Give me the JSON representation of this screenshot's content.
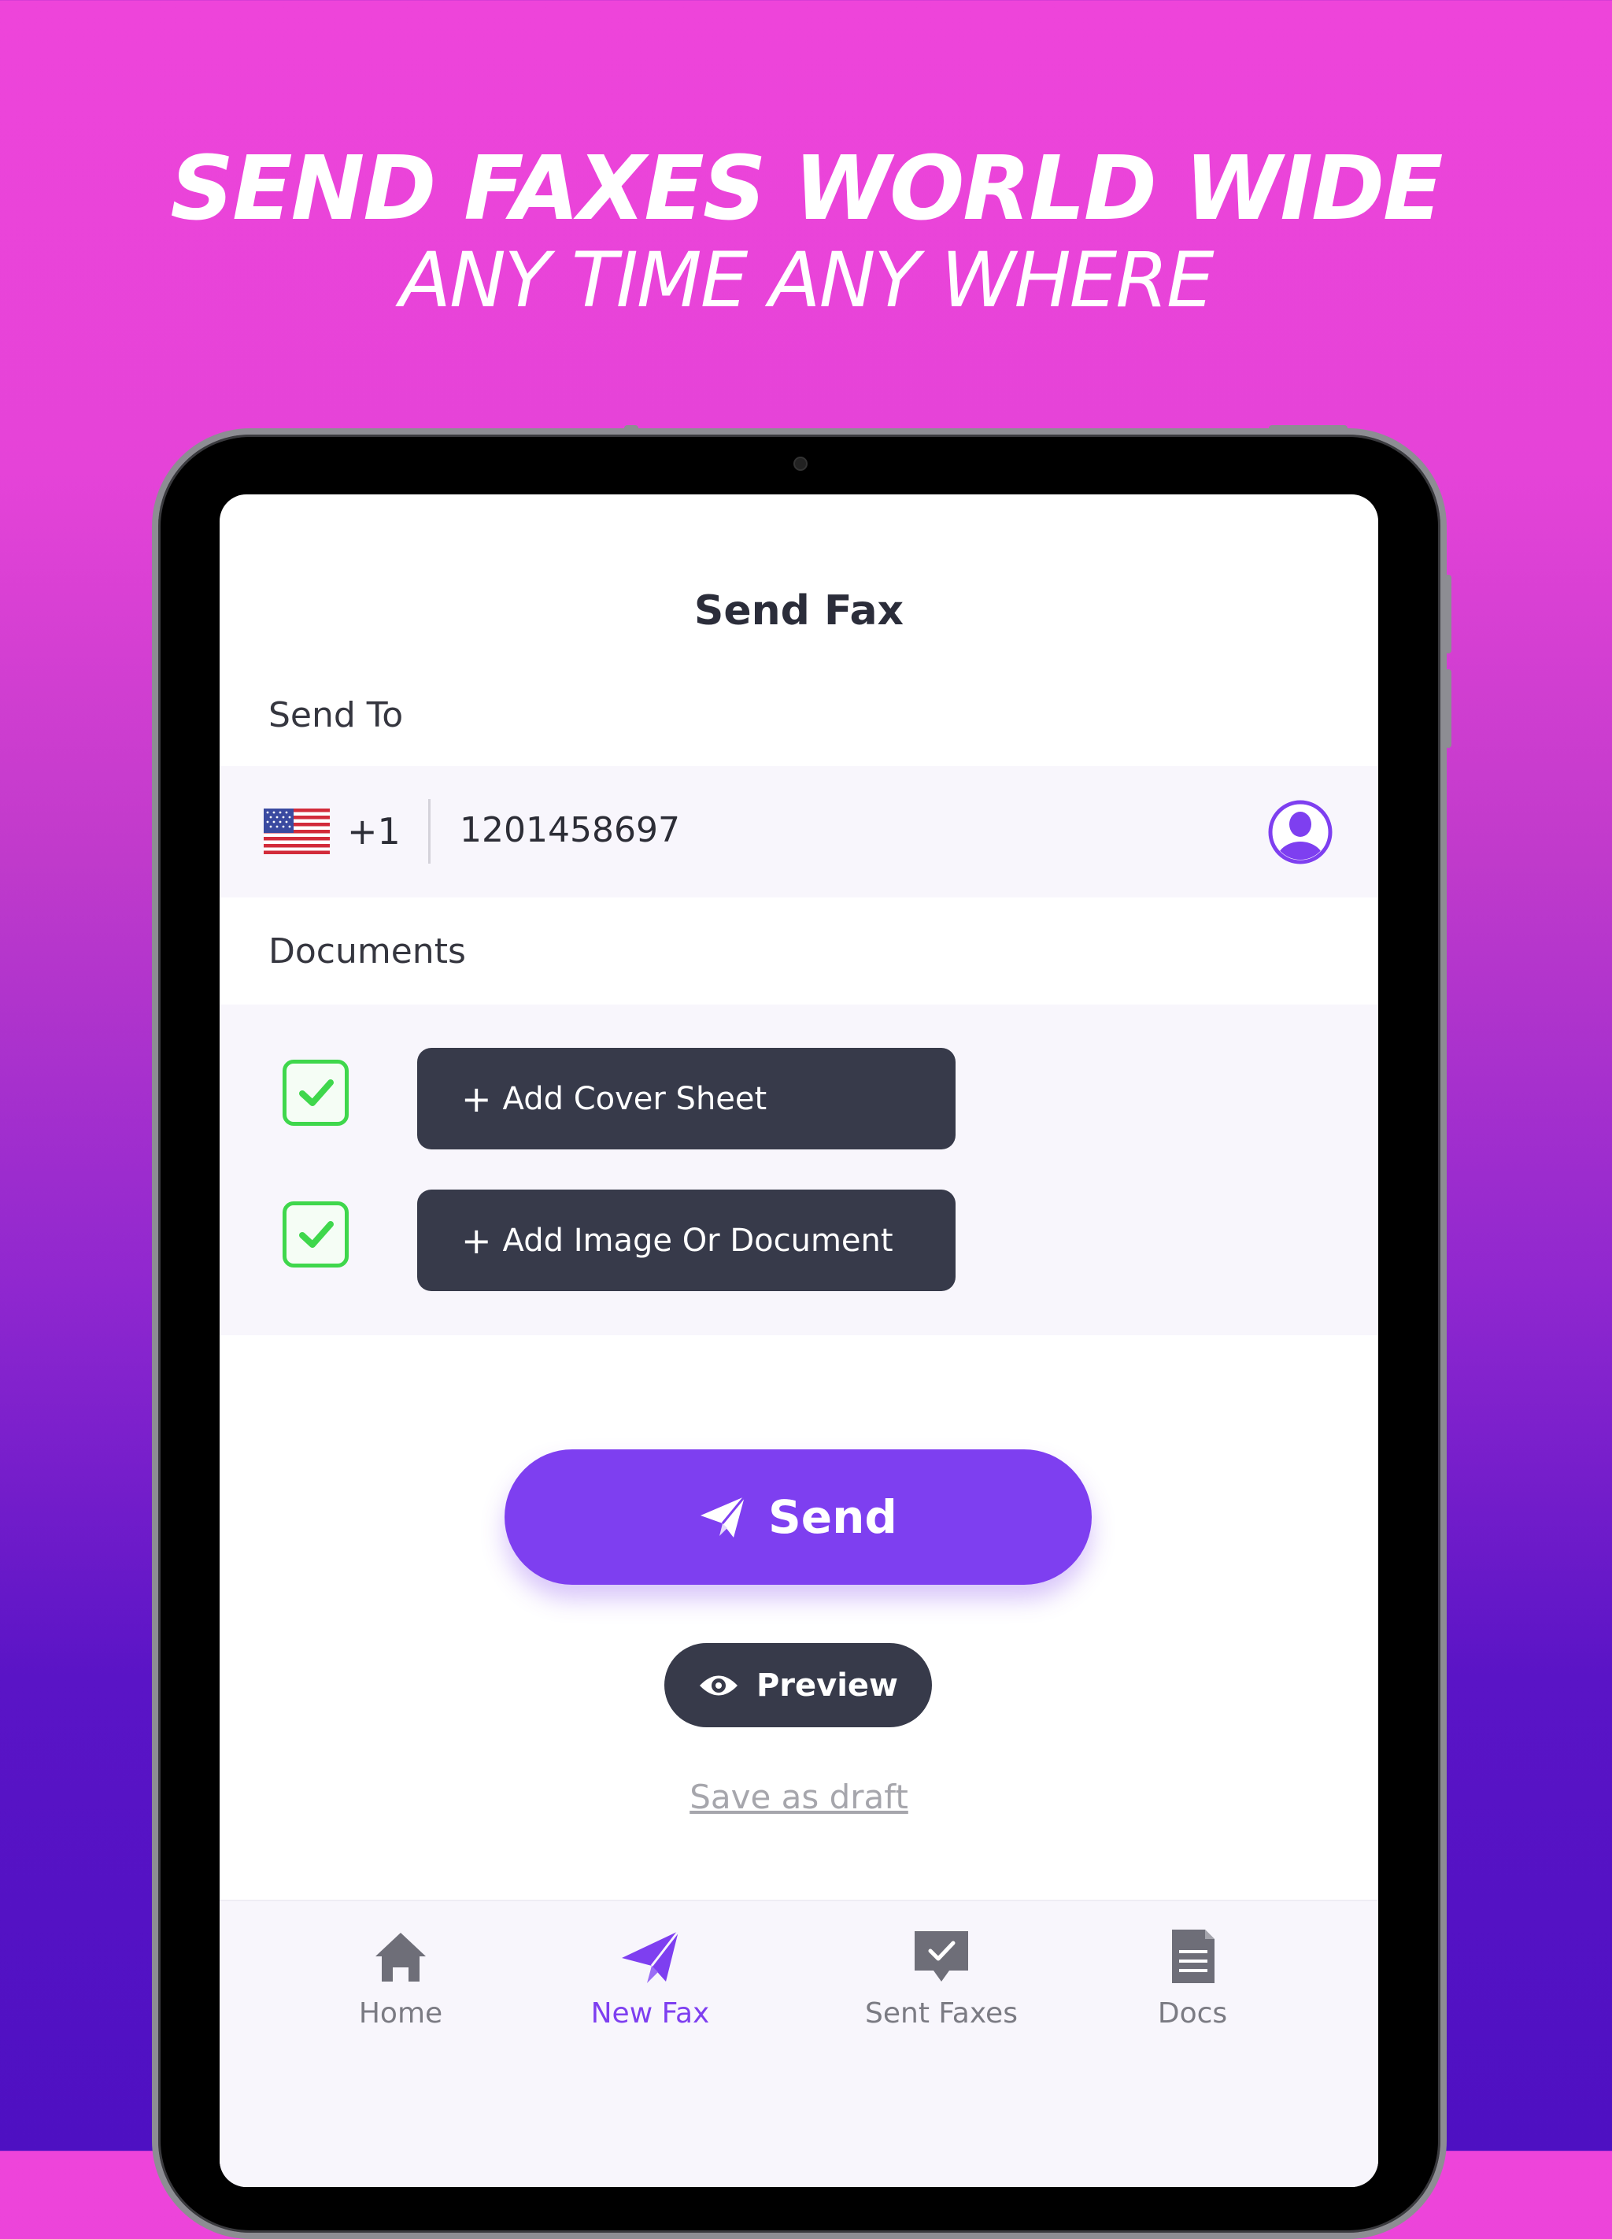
{
  "promo": {
    "headline": "SEND FAXES WORLD WIDE",
    "subheadline": "ANY TIME ANY WHERE"
  },
  "screen": {
    "title": "Send Fax",
    "send_to_label": "Send To",
    "phone": {
      "flag_icon": "us-flag-icon",
      "country_code": "+1",
      "number": "1201458697",
      "contact_icon": "contact-person-icon"
    },
    "documents_label": "Documents",
    "documents": [
      {
        "checked": true,
        "label": "Add Cover Sheet"
      },
      {
        "checked": true,
        "label": "Add Image Or Document"
      }
    ],
    "send_label": "Send",
    "preview_label": "Preview",
    "draft_label": "Save as draft"
  },
  "tabs": [
    {
      "label": "Home",
      "icon": "home-icon",
      "active": false
    },
    {
      "label": "New Fax",
      "icon": "paper-plane-icon",
      "active": true
    },
    {
      "label": "Sent Faxes",
      "icon": "sent-check-icon",
      "active": false
    },
    {
      "label": "Docs",
      "icon": "document-icon",
      "active": false
    }
  ],
  "colors": {
    "accent": "#7e3ff0",
    "dark_button": "#373a4a",
    "check_green": "#3fd74c",
    "background_top": "#ee44da",
    "background_bottom": "#4e10c2"
  }
}
